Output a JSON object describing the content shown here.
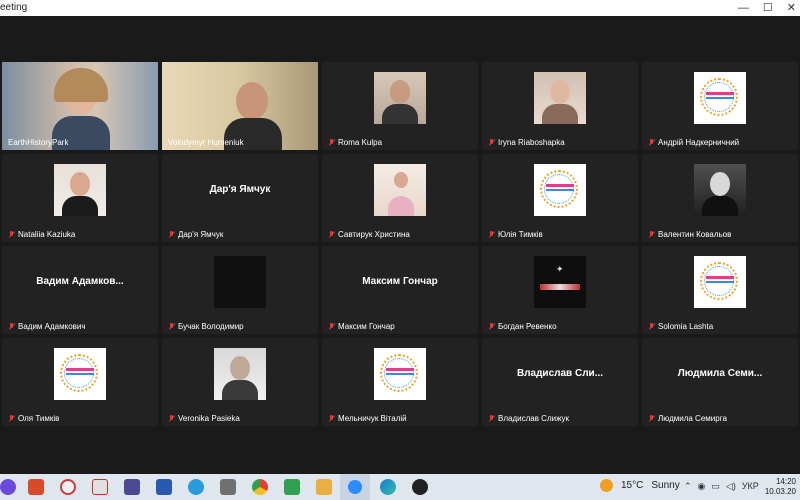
{
  "window": {
    "title": "eeting"
  },
  "participants": [
    {
      "name": "EarthHistoryPark",
      "display": "video",
      "active": true
    },
    {
      "name": "Volodymyr Humeniuk",
      "display": "video"
    },
    {
      "name": "Roma Kulpa",
      "display": "avatar"
    },
    {
      "name": "Iryna Riaboshapka",
      "display": "avatar"
    },
    {
      "name": "Андрій Надкерничний",
      "display": "logo"
    },
    {
      "name": "Nataliia Kaziuka",
      "display": "avatar"
    },
    {
      "name": "Дар'я Ямчук",
      "display": "text",
      "big_text": "Дар'я Ямчук"
    },
    {
      "name": "Савтирук Христина",
      "display": "avatar"
    },
    {
      "name": "Юлія Тимків",
      "display": "logo"
    },
    {
      "name": "Валентин Ковальов",
      "display": "avatar"
    },
    {
      "name": "Вадим Адамкович",
      "display": "text",
      "big_text": "Вадим  Адамков..."
    },
    {
      "name": "Бучак Володимир",
      "display": "avatar"
    },
    {
      "name": "Максим Гончар",
      "display": "text",
      "big_text": "Максим Гончар"
    },
    {
      "name": "Богдан Ревенко",
      "display": "avatar"
    },
    {
      "name": "Solomia Lashta",
      "display": "logo"
    },
    {
      "name": "Оля Тимків",
      "display": "logo"
    },
    {
      "name": "Veronika Pasieka",
      "display": "avatar"
    },
    {
      "name": "Мельничук Віталій",
      "display": "logo"
    },
    {
      "name": "Владислав Слижук",
      "display": "text",
      "big_text": "Владислав  Сли..."
    },
    {
      "name": "Людмила Семирга",
      "display": "text",
      "big_text": "Людмила  Семи..."
    }
  ],
  "taskbar": {
    "weather": {
      "temp": "15°C",
      "condition": "Sunny"
    },
    "lang": "УКР",
    "time": "14:20",
    "date": "10.03.20"
  }
}
